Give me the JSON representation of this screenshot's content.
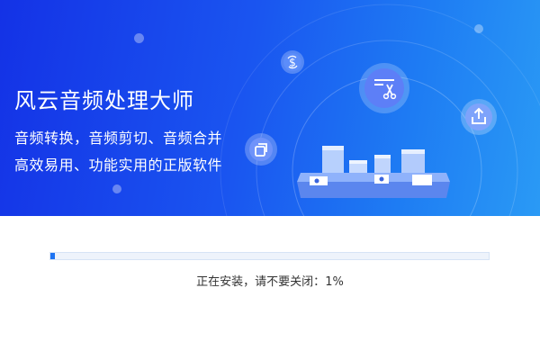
{
  "hero": {
    "title": "风云音频处理大师",
    "tagline_line1": "音频转换，音频剪切、音频合并",
    "tagline_line2": "高效易用、功能实用的正版软件"
  },
  "icons": {
    "currency": "currency-swap-icon",
    "cut": "scissors-cut-icon",
    "export": "export-icon",
    "copy": "copy-windows-icon"
  },
  "progress": {
    "fraction": 0.01,
    "status_prefix": "正在安装，请不要关闭：",
    "percent_text": "1%"
  },
  "colors": {
    "accent": "#1d73f2",
    "hero_start": "#1432e6",
    "hero_end": "#2a9af5"
  }
}
